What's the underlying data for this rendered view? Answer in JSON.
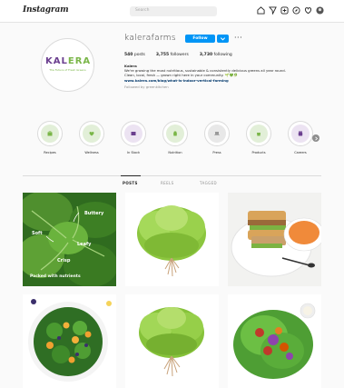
{
  "nav": {
    "logo": "Instagram",
    "search_placeholder": "Search",
    "icons": [
      "home-icon",
      "messenger-icon",
      "new-post-icon",
      "explore-icon",
      "activity-icon",
      "profile-avatar"
    ]
  },
  "profile": {
    "avatar": {
      "brand_left": "KAL",
      "brand_right": "ERA",
      "tagline": "The Future of Fresh Greens"
    },
    "username": "kalerafarms",
    "follow_label": "Follow",
    "more_label": "···",
    "stats": [
      {
        "value": "540",
        "label": "posts"
      },
      {
        "value": "3,755",
        "label": "followers"
      },
      {
        "value": "3,730",
        "label": "following"
      }
    ],
    "bio": {
      "name": "Kalera",
      "line1": "We're growing the most nutritious, sustainable & consistently delicious greens all year round.",
      "line2": "Clean, local, fresh — grown right here in your community. 🌱💚🥬",
      "link": "www.kalera.com/blog/what-is-indoor-vertical-farming",
      "follows": "Followed by greenkitchen"
    },
    "colors": {
      "brand_purple": "#6b3f8f",
      "brand_green": "#7ab648",
      "follow_blue": "#0095f6"
    }
  },
  "highlights": [
    {
      "label": "Recipes",
      "icon": "shopping-bag-icon"
    },
    {
      "label": "Wellness",
      "icon": "heart-icon"
    },
    {
      "label": "In Stock",
      "icon": "box-icon"
    },
    {
      "label": "Nutrition",
      "icon": "bottle-icon"
    },
    {
      "label": "Press",
      "icon": "laptop-icon"
    },
    {
      "label": "Products",
      "icon": "bag-icon"
    },
    {
      "label": "Careers",
      "icon": "jar-icon"
    }
  ],
  "tabs": [
    {
      "label": "POSTS",
      "active": true
    },
    {
      "label": "REELS",
      "active": false
    },
    {
      "label": "TAGGED",
      "active": false
    }
  ],
  "posts": [
    {
      "name": "post-butterhead-labeled",
      "alt": "lettuce leaves with labels"
    },
    {
      "name": "post-lettuce-head",
      "alt": "lettuce head with roots"
    },
    {
      "name": "post-sandwich-soup",
      "alt": "grilled sandwich and tomato soup"
    },
    {
      "name": "post-salad-bowl",
      "alt": "green salad with citrus"
    },
    {
      "name": "post-lettuce-head-2",
      "alt": "lettuce head with roots"
    },
    {
      "name": "post-lettuce-wraps",
      "alt": "lettuce wraps with dressing"
    }
  ],
  "tile_labels": {
    "t1": "Buttery",
    "t2": "Soft",
    "t3": "Leafy",
    "t4": "Crisp",
    "t5": "Packed with nutrients"
  }
}
